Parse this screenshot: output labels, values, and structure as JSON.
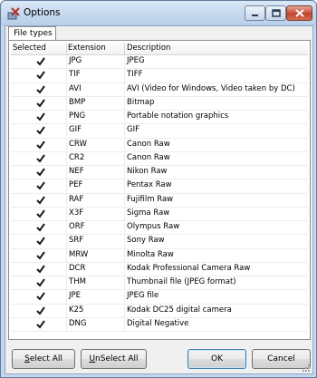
{
  "window": {
    "title": "Options"
  },
  "tabs": [
    {
      "label": "File types"
    }
  ],
  "table": {
    "headers": {
      "selected": "Selected",
      "extension": "Extension",
      "description": "Description"
    },
    "rows": [
      {
        "selected": true,
        "extension": "JPG",
        "description": "JPEG"
      },
      {
        "selected": true,
        "extension": "TIF",
        "description": "TIFF"
      },
      {
        "selected": true,
        "extension": "AVI",
        "description": "AVI (Video for Windows, Video taken by DC)"
      },
      {
        "selected": true,
        "extension": "BMP",
        "description": "Bitmap"
      },
      {
        "selected": true,
        "extension": "PNG",
        "description": "Portable notation graphics"
      },
      {
        "selected": true,
        "extension": "GIF",
        "description": "GIF"
      },
      {
        "selected": true,
        "extension": "CRW",
        "description": "Canon Raw"
      },
      {
        "selected": true,
        "extension": "CR2",
        "description": "Canon Raw"
      },
      {
        "selected": true,
        "extension": "NEF",
        "description": "Nikon Raw"
      },
      {
        "selected": true,
        "extension": "PEF",
        "description": "Pentax Raw"
      },
      {
        "selected": true,
        "extension": "RAF",
        "description": "Fujifilm Raw"
      },
      {
        "selected": true,
        "extension": "X3F",
        "description": "Sigma Raw"
      },
      {
        "selected": true,
        "extension": "ORF",
        "description": "Olympus Raw"
      },
      {
        "selected": true,
        "extension": "SRF",
        "description": "Sony Raw"
      },
      {
        "selected": true,
        "extension": "MRW",
        "description": "Minolta Raw"
      },
      {
        "selected": true,
        "extension": "DCR",
        "description": "Kodak Professional Camera Raw"
      },
      {
        "selected": true,
        "extension": "THM",
        "description": "Thumbnail file (JPEG format)"
      },
      {
        "selected": true,
        "extension": "JPE",
        "description": "JPEG file"
      },
      {
        "selected": true,
        "extension": "K25",
        "description": "Kodak DC25 digital camera"
      },
      {
        "selected": true,
        "extension": "DNG",
        "description": "Digital Negative"
      }
    ]
  },
  "buttons": {
    "select_all": {
      "accel": "S",
      "rest": "elect All"
    },
    "unselect_all": {
      "accel": "U",
      "rest": "nSelect All"
    },
    "ok": "OK",
    "cancel": "Cancel"
  },
  "icons": {
    "app": "options-app-icon",
    "minimize": "minimize-icon",
    "maximize": "maximize-icon",
    "close": "close-icon",
    "check": "checkmark-icon"
  }
}
